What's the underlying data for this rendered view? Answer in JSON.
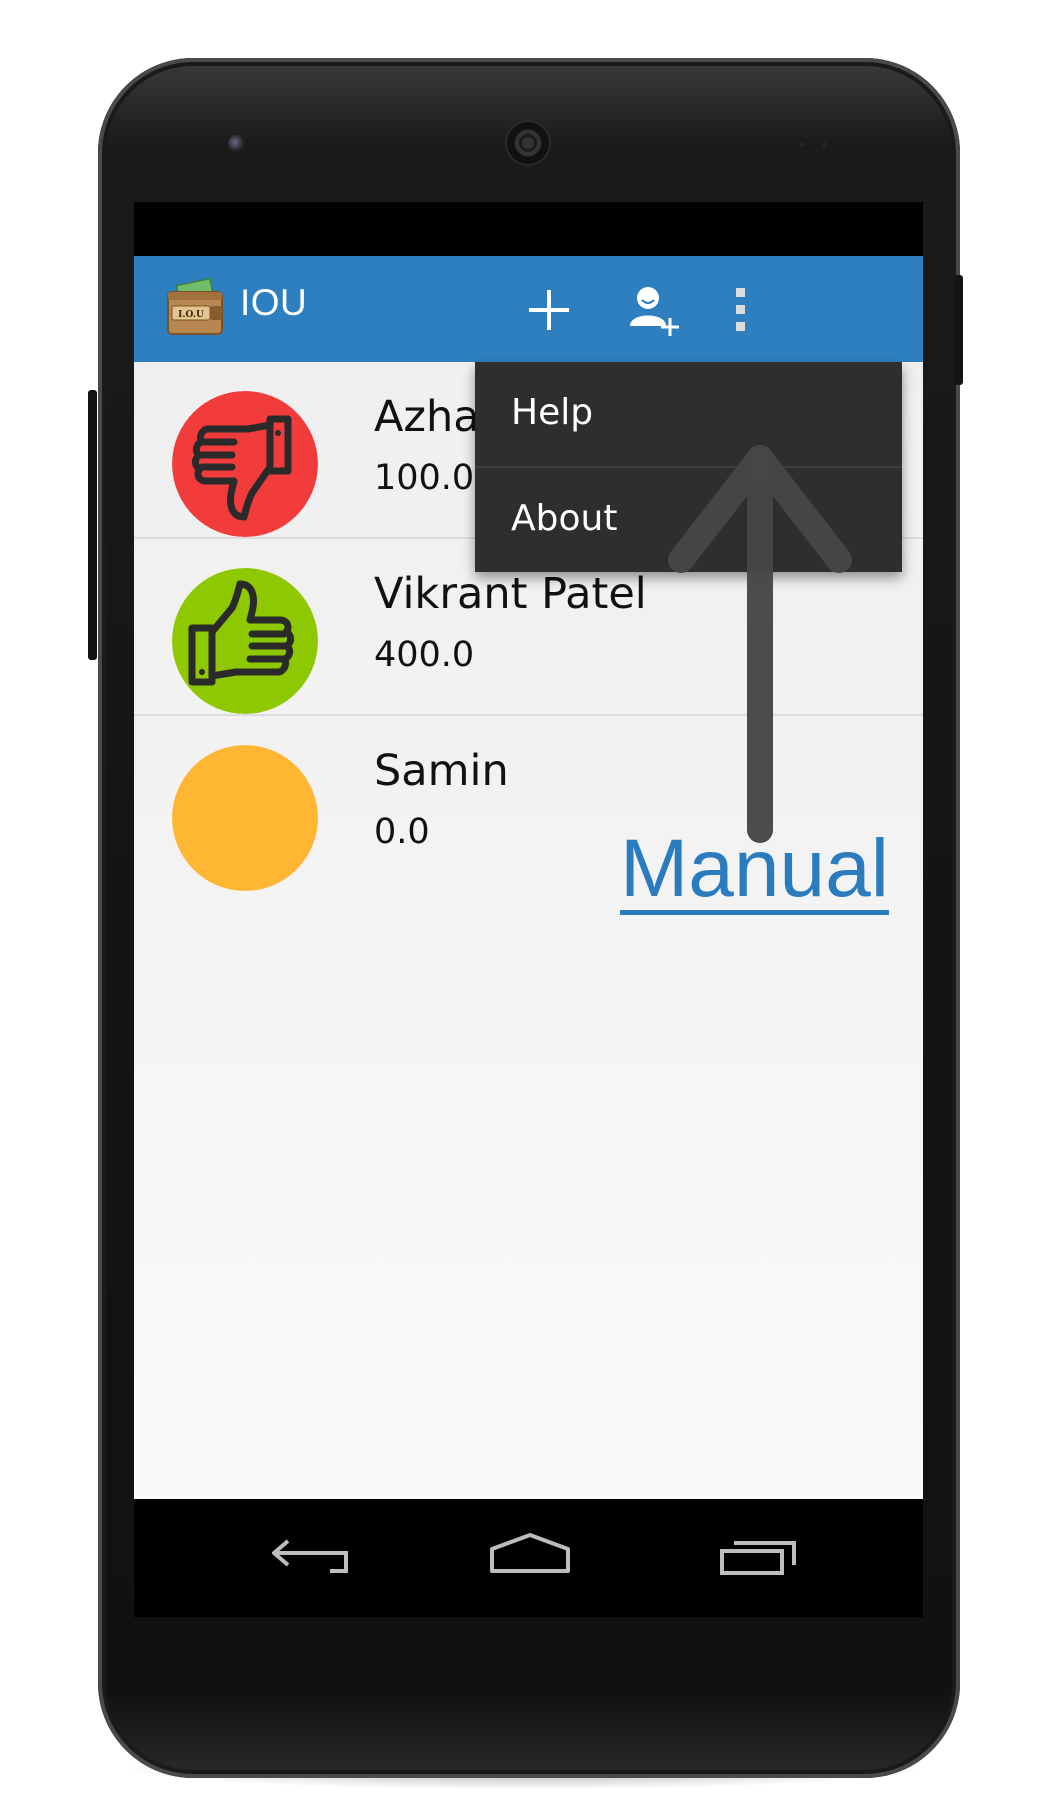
{
  "app": {
    "title": "IOU",
    "logo_icon": "iou-wallet-logo"
  },
  "action_bar": {
    "color": "#2d7fbf",
    "actions": [
      {
        "icon": "plus-icon",
        "name": "add-transaction"
      },
      {
        "icon": "add-person-icon",
        "name": "add-contact"
      },
      {
        "icon": "overflow-menu-icon",
        "name": "overflow-menu"
      }
    ]
  },
  "contacts": [
    {
      "name": "Azha",
      "amount": "100.0",
      "status": "owes",
      "avatar_color": "#f23c3c",
      "icon": "thumbs-down-icon"
    },
    {
      "name": "Vikrant Patel",
      "amount": "400.0",
      "status": "owed",
      "avatar_color": "#8ec800",
      "icon": "thumbs-up-icon"
    },
    {
      "name": "Samin",
      "amount": "0.0",
      "status": "settled",
      "avatar_color": "#ffb733",
      "icon": "none"
    }
  ],
  "overflow_menu": {
    "items": [
      "Help",
      "About"
    ],
    "background": "#2e2e2e"
  },
  "annotation": {
    "label": "Manual",
    "color": "#2a7cbf",
    "arrow_icon": "up-arrow-icon"
  },
  "nav_bar": {
    "buttons": [
      "back-icon",
      "home-icon",
      "recents-icon"
    ]
  }
}
